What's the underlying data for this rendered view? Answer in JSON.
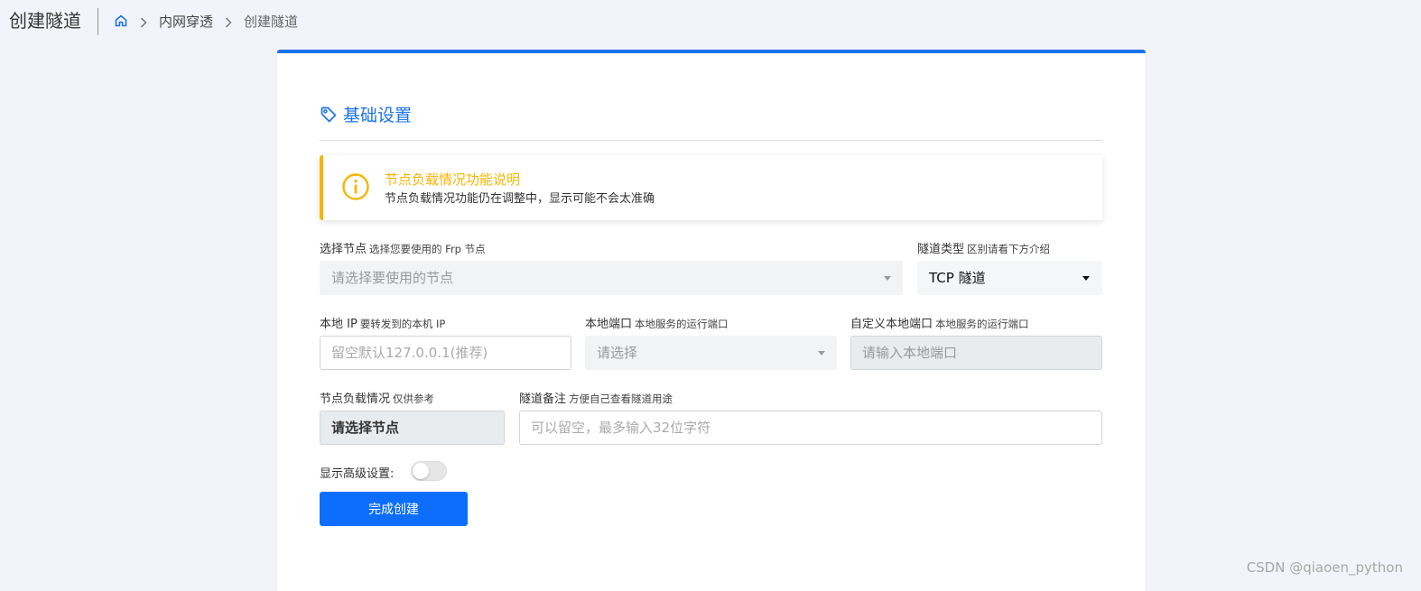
{
  "header": {
    "title": "创建隧道",
    "breadcrumb": [
      "内网穿透",
      "创建隧道"
    ]
  },
  "section": {
    "title": "基础设置"
  },
  "alert": {
    "title": "节点负载情况功能说明",
    "text": "节点负载情况功能仍在调整中，显示可能不会太准确"
  },
  "form": {
    "node": {
      "label": "选择节点",
      "hint": "选择您要使用的 Frp 节点",
      "placeholder": "请选择要使用的节点"
    },
    "tunnel_type": {
      "label": "隧道类型",
      "hint": "区别请看下方介绍",
      "value": "TCP 隧道"
    },
    "local_ip": {
      "label": "本地 IP",
      "hint": "要转发到的本机 IP",
      "placeholder": "留空默认127.0.0.1(推荐)"
    },
    "local_port": {
      "label": "本地端口",
      "hint": "本地服务的运行端口",
      "placeholder": "请选择"
    },
    "custom_port": {
      "label": "自定义本地端口",
      "hint": "本地服务的运行端口",
      "placeholder": "请输入本地端口"
    },
    "node_load": {
      "label": "节点负载情况",
      "hint": "仅供参考",
      "value": "请选择节点"
    },
    "remark": {
      "label": "隧道备注",
      "hint": "方便自己查看隧道用途",
      "placeholder": "可以留空，最多输入32位字符"
    },
    "advanced": {
      "label": "显示高级设置:",
      "enabled": false
    },
    "submit_label": "完成创建"
  },
  "watermark": "CSDN @qiaoen_python",
  "colors": {
    "accent": "#1a73e8",
    "warning": "#f7b500",
    "primary_button": "#0d6efd",
    "background": "#f3f4fb"
  }
}
